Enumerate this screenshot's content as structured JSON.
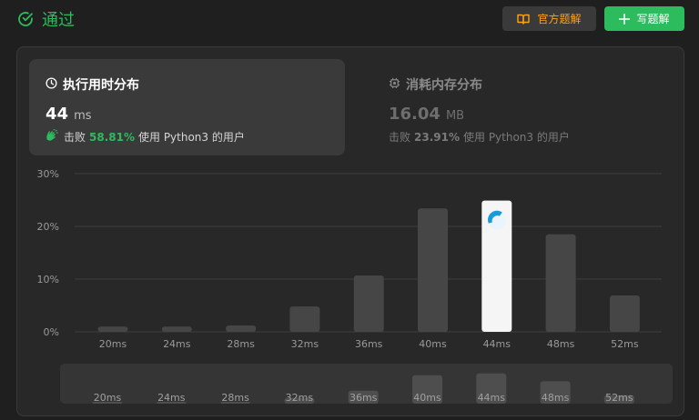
{
  "header": {
    "status_label": "通过",
    "solution_button": "官方题解",
    "write_button": "写题解",
    "colors": {
      "accept": "#2cbb5d",
      "solution_text": "#ffa116"
    }
  },
  "runtime_card": {
    "title": "执行用时分布",
    "value": "44",
    "unit": "ms",
    "beats_prefix": "击败",
    "beats_pct": "58.81%",
    "beats_suffix": "使用 Python3 的用户",
    "icon": "clock-icon"
  },
  "memory_card": {
    "title": "消耗内存分布",
    "value": "16.04",
    "unit": "MB",
    "beats_prefix": "击败",
    "beats_pct": "23.91%",
    "beats_suffix": "使用 Python3 的用户",
    "icon": "chip-icon"
  },
  "chart_data": {
    "type": "bar",
    "categories": [
      "20ms",
      "24ms",
      "28ms",
      "32ms",
      "36ms",
      "40ms",
      "44ms",
      "48ms",
      "52ms"
    ],
    "values": [
      1.0,
      1.0,
      1.2,
      4.8,
      10.7,
      23.4,
      24.9,
      18.5,
      6.9
    ],
    "ylim": [
      0,
      30
    ],
    "yticks": [
      "0%",
      "10%",
      "20%",
      "30%"
    ],
    "ytick_values": [
      0,
      10,
      20,
      30
    ],
    "highlight_category": "44ms",
    "grid": true,
    "colors": {
      "bar": "#464646",
      "highlight": "#f5f5f5",
      "grid": "#3e3e3e"
    }
  },
  "minimap": {
    "categories": [
      "20ms",
      "24ms",
      "28ms",
      "32ms",
      "36ms",
      "40ms",
      "44ms",
      "48ms",
      "52ms"
    ],
    "values": [
      1.0,
      1.0,
      1.2,
      4.8,
      10.7,
      23.4,
      24.9,
      18.5,
      6.9
    ]
  }
}
